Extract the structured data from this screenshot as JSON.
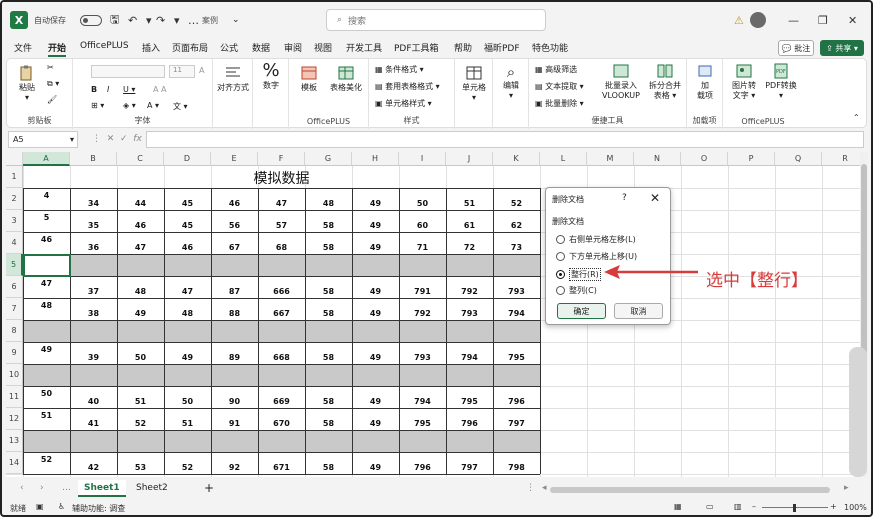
{
  "titlebar": {
    "autosave_label": "自动保存",
    "toggle_state": "关",
    "filename": "案例",
    "search_placeholder": "搜索",
    "warning_glyph": "⚠"
  },
  "menu": [
    "文件",
    "开始",
    "OfficePLUS",
    "插入",
    "页面布局",
    "公式",
    "数据",
    "审阅",
    "视图",
    "开发工具",
    "PDF工具箱",
    "帮助",
    "福昕PDF",
    "特色功能"
  ],
  "menu_active_index": 1,
  "comment_label": "批注",
  "share_label": "共享",
  "ribbon": {
    "paste": "粘贴",
    "clipboard_label": "剪贴板",
    "font_size": "11",
    "font_label": "字体",
    "align": "对齐方式",
    "number": "数字",
    "number_glyph": "%",
    "template": "模板",
    "table_style": "表格美化",
    "officeplus_label": "OfficePLUS",
    "cond_format": "条件格式",
    "table_format": "套用表格格式",
    "cell_style": "单元格样式",
    "style_label": "样式",
    "cells": "单元格",
    "edit": "编辑",
    "advanced_filter": "高级筛选",
    "text_extract": "文本提取",
    "batch_delete": "批量删除",
    "batch_vlookup_1": "批量录入",
    "batch_vlookup_2": "VLOOKUP",
    "split_1": "拆分合并",
    "split_2": "表格",
    "tools_label": "便捷工具",
    "addin_1": "加",
    "addin_2": "载项",
    "addin_label": "加载项",
    "img2text_1": "图片转",
    "img2text_2": "文字",
    "pdf_1": "PDF转换",
    "pdf_2": "",
    "officeplus2_label": "OfficePLUS"
  },
  "formula_bar": {
    "name_box": "A5",
    "fx": "fx",
    "value": ""
  },
  "sheet": {
    "title": "模拟数据",
    "columns": [
      "A",
      "B",
      "C",
      "D",
      "E",
      "F",
      "G",
      "H",
      "I",
      "J",
      "K",
      "L",
      "M",
      "N",
      "O",
      "P",
      "Q",
      "R"
    ],
    "row_numbers": [
      "1",
      "2",
      "3",
      "4",
      "5",
      "6",
      "7",
      "8",
      "9",
      "10",
      "11",
      "12",
      "13",
      "14"
    ],
    "selected_cell": "A5",
    "rows": {
      "2": [
        "4",
        "34",
        "44",
        "45",
        "46",
        "47",
        "48",
        "49",
        "50",
        "51",
        "52"
      ],
      "3": [
        "5",
        "35",
        "46",
        "45",
        "56",
        "57",
        "58",
        "49",
        "60",
        "61",
        "62"
      ],
      "4": [
        "46",
        "36",
        "47",
        "46",
        "67",
        "68",
        "58",
        "49",
        "71",
        "72",
        "73"
      ],
      "6": [
        "47",
        "37",
        "48",
        "47",
        "87",
        "666",
        "58",
        "49",
        "791",
        "792",
        "793"
      ],
      "7": [
        "48",
        "38",
        "49",
        "48",
        "88",
        "667",
        "58",
        "49",
        "792",
        "793",
        "794"
      ],
      "9": [
        "49",
        "39",
        "50",
        "49",
        "89",
        "668",
        "58",
        "49",
        "793",
        "794",
        "795"
      ],
      "11": [
        "50",
        "40",
        "51",
        "50",
        "90",
        "669",
        "58",
        "49",
        "794",
        "795",
        "796"
      ],
      "12": [
        "51",
        "41",
        "52",
        "51",
        "91",
        "670",
        "58",
        "49",
        "795",
        "796",
        "797"
      ],
      "14": [
        "52",
        "42",
        "53",
        "52",
        "92",
        "671",
        "58",
        "49",
        "796",
        "797",
        "798"
      ]
    }
  },
  "dialog": {
    "title": "删除文档",
    "help": "?",
    "close": "✕",
    "group": "删除文档",
    "options": [
      "右侧单元格左移(L)",
      "下方单元格上移(U)",
      "整行(R)",
      "整列(C)"
    ],
    "selected_index": 2,
    "ok": "确定",
    "cancel": "取消"
  },
  "annotation": {
    "text": "选中【整行】",
    "color": "#d83b3b"
  },
  "tabs": [
    "Sheet1",
    "Sheet2"
  ],
  "add_sheet": "+",
  "status": {
    "ready": "就绪",
    "accessibility": "辅助功能: 调查",
    "zoom": "100%"
  },
  "colors": {
    "accent": "#217346",
    "gray_row": "#c9c9c9",
    "annotation": "#d83b3b"
  }
}
